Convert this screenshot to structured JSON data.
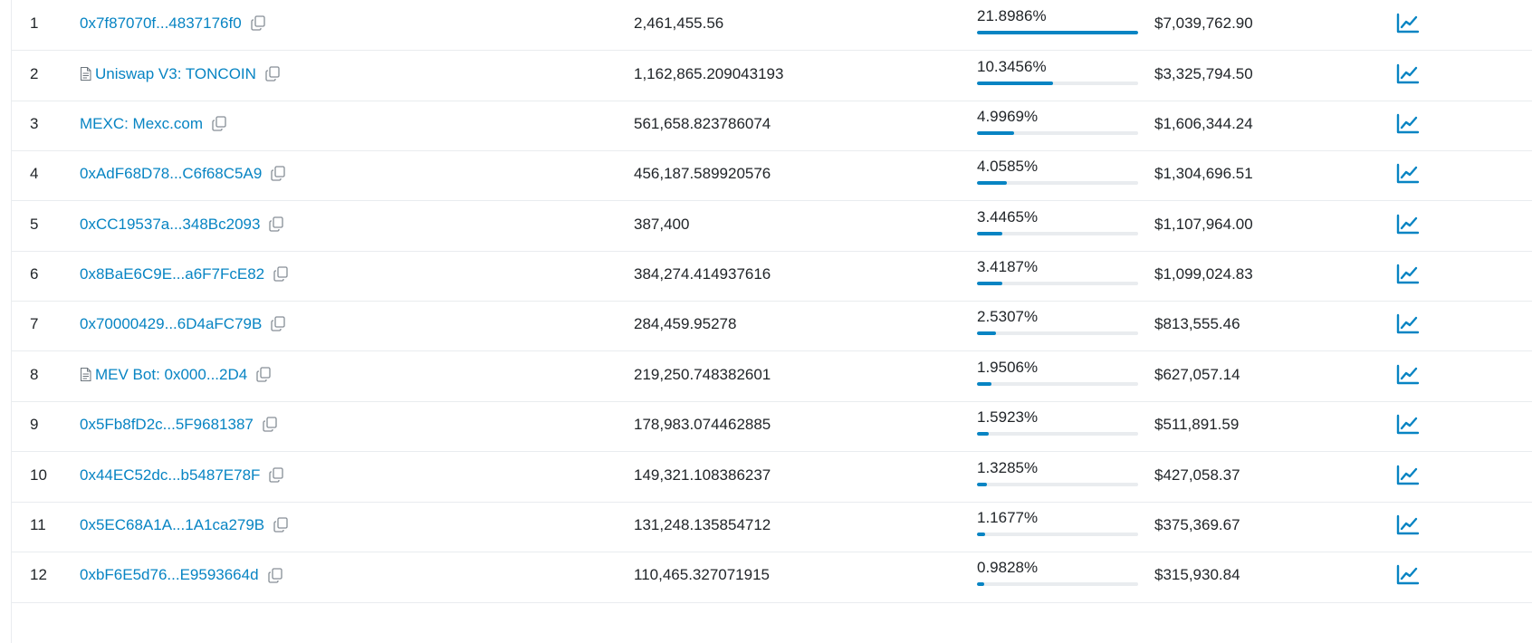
{
  "accent_color": "#0784c3",
  "icons": {
    "contract": "document-icon",
    "copy": "copy-icon",
    "analytics": "chart-line-icon"
  },
  "holders": [
    {
      "rank": "1",
      "address": "0x7f87070f...4837176f0",
      "is_contract": false,
      "quantity": "2,461,455.56",
      "percentage": "21.8986%",
      "percentage_value": 21.8986,
      "value": "$7,039,762.90"
    },
    {
      "rank": "2",
      "address": "Uniswap V3: TONCOIN",
      "is_contract": true,
      "quantity": "1,162,865.209043193",
      "percentage": "10.3456%",
      "percentage_value": 10.3456,
      "value": "$3,325,794.50"
    },
    {
      "rank": "3",
      "address": "MEXC: Mexc.com",
      "is_contract": false,
      "quantity": "561,658.823786074",
      "percentage": "4.9969%",
      "percentage_value": 4.9969,
      "value": "$1,606,344.24"
    },
    {
      "rank": "4",
      "address": "0xAdF68D78...C6f68C5A9",
      "is_contract": false,
      "quantity": "456,187.589920576",
      "percentage": "4.0585%",
      "percentage_value": 4.0585,
      "value": "$1,304,696.51"
    },
    {
      "rank": "5",
      "address": "0xCC19537a...348Bc2093",
      "is_contract": false,
      "quantity": "387,400",
      "percentage": "3.4465%",
      "percentage_value": 3.4465,
      "value": "$1,107,964.00"
    },
    {
      "rank": "6",
      "address": "0x8BaE6C9E...a6F7FcE82",
      "is_contract": false,
      "quantity": "384,274.414937616",
      "percentage": "3.4187%",
      "percentage_value": 3.4187,
      "value": "$1,099,024.83"
    },
    {
      "rank": "7",
      "address": "0x70000429...6D4aFC79B",
      "is_contract": false,
      "quantity": "284,459.95278",
      "percentage": "2.5307%",
      "percentage_value": 2.5307,
      "value": "$813,555.46"
    },
    {
      "rank": "8",
      "address": "MEV Bot: 0x000...2D4",
      "is_contract": true,
      "quantity": "219,250.748382601",
      "percentage": "1.9506%",
      "percentage_value": 1.9506,
      "value": "$627,057.14"
    },
    {
      "rank": "9",
      "address": "0x5Fb8fD2c...5F9681387",
      "is_contract": false,
      "quantity": "178,983.074462885",
      "percentage": "1.5923%",
      "percentage_value": 1.5923,
      "value": "$511,891.59"
    },
    {
      "rank": "10",
      "address": "0x44EC52dc...b5487E78F",
      "is_contract": false,
      "quantity": "149,321.108386237",
      "percentage": "1.3285%",
      "percentage_value": 1.3285,
      "value": "$427,058.37"
    },
    {
      "rank": "11",
      "address": "0x5EC68A1A...1A1ca279B",
      "is_contract": false,
      "quantity": "131,248.135854712",
      "percentage": "1.1677%",
      "percentage_value": 1.1677,
      "value": "$375,369.67"
    },
    {
      "rank": "12",
      "address": "0xbF6E5d76...E9593664d",
      "is_contract": false,
      "quantity": "110,465.327071915",
      "percentage": "0.9828%",
      "percentage_value": 0.9828,
      "value": "$315,930.84"
    }
  ]
}
